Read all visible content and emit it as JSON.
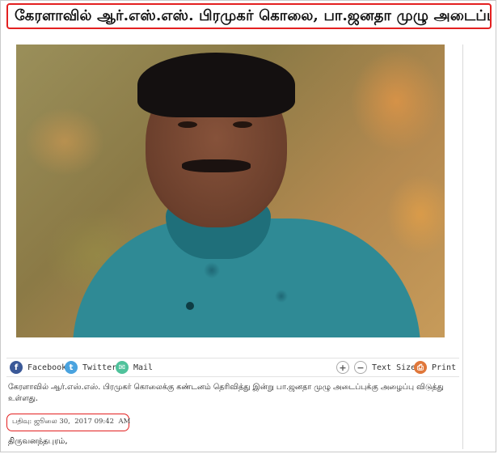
{
  "headline": "கேரளாவில் ஆர்.எஸ்.எஸ். பிரமுகர் கொலை, பா.ஜனதா முழு அடைப்புக்கு அழைப்பு",
  "share_bar": {
    "facebook_label": "Facebook",
    "twitter_label": "Twitter",
    "mail_label": "Mail",
    "increase_icon": "plus-icon",
    "decrease_icon": "minus-icon",
    "text_size_label": "Text Size",
    "print_label": "Print"
  },
  "summary": "கேரளாவில் ஆர்.எஸ்.எஸ். பிரமுகர் கொலைக்கு கண்டனம் தெரிவித்து இன்று பா.ஜனதா முழு அடைப்புக்கு அழைப்பு விடுத்து உள்ளது.",
  "published": {
    "label": "பதிவு:",
    "date": "ஜூலை 30,  2017 09:42  AM"
  },
  "dateline": "திருவனந்தபுரம்,",
  "colors": {
    "highlight_border": "#e32020",
    "facebook": "#3b5998",
    "twitter": "#4aa3df",
    "mail": "#4fc29b",
    "print": "#e0773a"
  }
}
